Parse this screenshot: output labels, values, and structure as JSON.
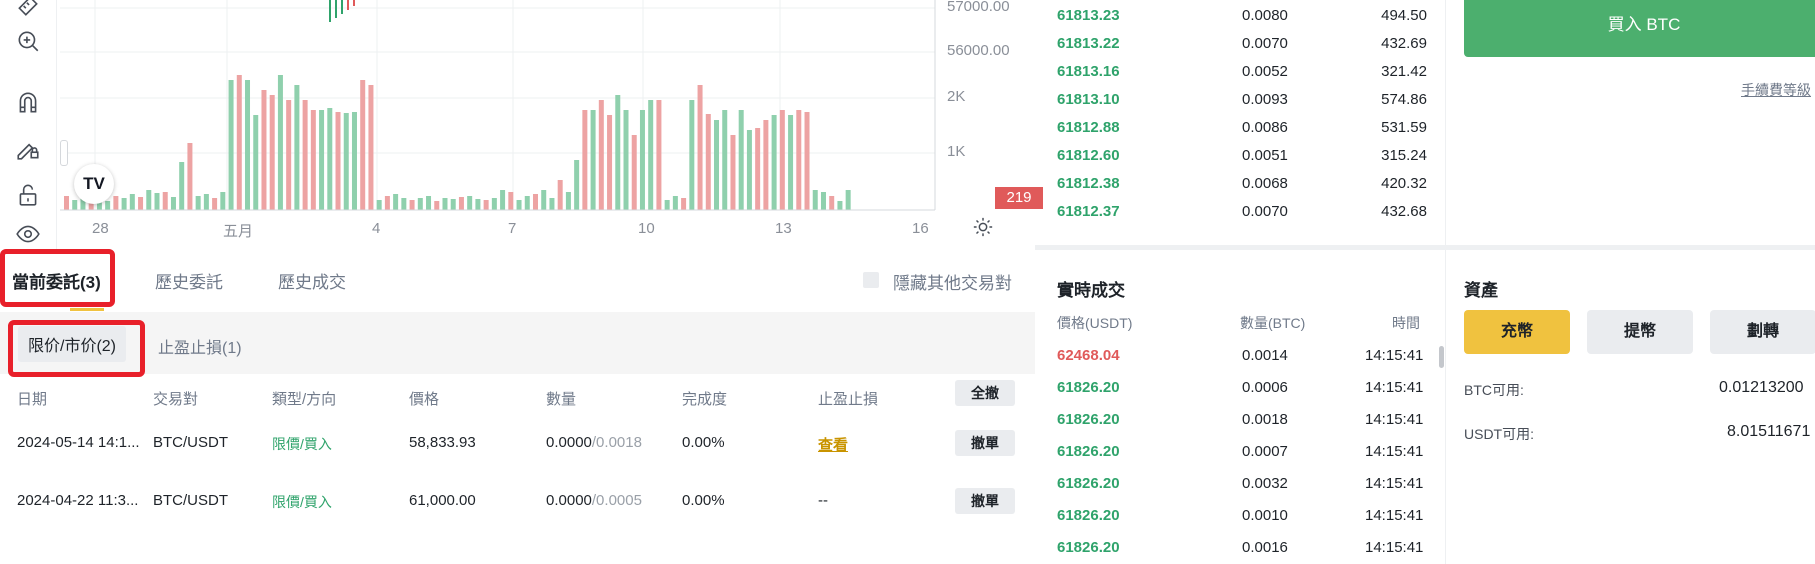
{
  "chart": {
    "y_labels": [
      "57000.00",
      "56000.00",
      "2K",
      "1K"
    ],
    "x_labels": [
      "28",
      "五月",
      "4",
      "7",
      "10",
      "13",
      "16"
    ],
    "last_volume": "219",
    "logo": "TV"
  },
  "orders": {
    "tabs": [
      "當前委託(3)",
      "歷史委託",
      "歷史成交"
    ],
    "hide_other_pairs": "隱藏其他交易對",
    "subtabs": [
      "限价/市价(2)",
      "止盈止損(1)"
    ],
    "columns": [
      "日期",
      "交易對",
      "類型/方向",
      "價格",
      "數量",
      "完成度",
      "止盈止損"
    ],
    "cancel_all": "全撤",
    "rows": [
      {
        "date": "2024-05-14 14:1...",
        "pair": "BTC/USDT",
        "type": "限價/買入",
        "price": "58,833.93",
        "qty_filled": "0.0000",
        "qty_total": "/0.0018",
        "completion": "0.00%",
        "tpsl": "查看",
        "action": "撤單"
      },
      {
        "date": "2024-04-22 11:3...",
        "pair": "BTC/USDT",
        "type": "限價/買入",
        "price": "61,000.00",
        "qty_filled": "0.0000",
        "qty_total": "/0.0005",
        "completion": "0.00%",
        "tpsl": "--",
        "action": "撤單"
      }
    ]
  },
  "orderbook": {
    "rows": [
      [
        "61813.23",
        "0.0080",
        "494.50"
      ],
      [
        "61813.22",
        "0.0070",
        "432.69"
      ],
      [
        "61813.16",
        "0.0052",
        "321.42"
      ],
      [
        "61813.10",
        "0.0093",
        "574.86"
      ],
      [
        "61812.88",
        "0.0086",
        "531.59"
      ],
      [
        "61812.60",
        "0.0051",
        "315.24"
      ],
      [
        "61812.38",
        "0.0068",
        "420.32"
      ],
      [
        "61812.37",
        "0.0070",
        "432.68"
      ]
    ]
  },
  "trades": {
    "title": "實時成交",
    "headers": [
      "價格(USDT)",
      "數量(BTC)",
      "時間"
    ],
    "rows": [
      {
        "price": "62468.04",
        "qty": "0.0014",
        "time": "14:15:41",
        "side": "sell"
      },
      {
        "price": "61826.20",
        "qty": "0.0006",
        "time": "14:15:41",
        "side": "buy"
      },
      {
        "price": "61826.20",
        "qty": "0.0018",
        "time": "14:15:41",
        "side": "buy"
      },
      {
        "price": "61826.20",
        "qty": "0.0007",
        "time": "14:15:41",
        "side": "buy"
      },
      {
        "price": "61826.20",
        "qty": "0.0032",
        "time": "14:15:41",
        "side": "buy"
      },
      {
        "price": "61826.20",
        "qty": "0.0010",
        "time": "14:15:41",
        "side": "buy"
      },
      {
        "price": "61826.20",
        "qty": "0.0016",
        "time": "14:15:41",
        "side": "buy"
      }
    ]
  },
  "trade_panel": {
    "buy_button": "買入 BTC",
    "fee_link": "手續費等級",
    "assets_title": "資產",
    "deposit": "充幣",
    "withdraw": "提幣",
    "transfer": "劃轉",
    "btc_label": "BTC可用:",
    "btc_value": "0.01213200",
    "usdt_label": "USDT可用:",
    "usdt_value": "8.01511671"
  },
  "colors": {
    "buy": "#2fa36b",
    "sell": "#e05a5a",
    "yellow": "#f0c23f",
    "highlight": "#e8202a"
  }
}
